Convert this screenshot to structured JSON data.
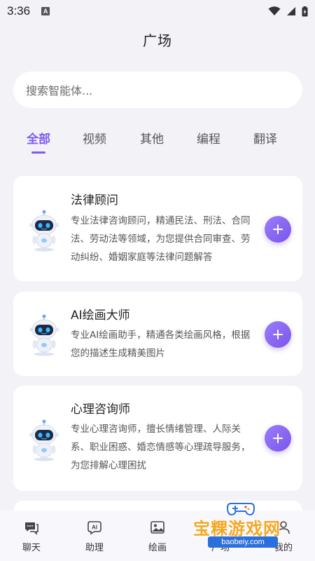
{
  "status_bar": {
    "time": "3:36",
    "notification_badge": "A"
  },
  "header": {
    "title": "广场"
  },
  "search": {
    "placeholder": "搜索智能体..."
  },
  "tabs": [
    {
      "label": "全部",
      "active": true
    },
    {
      "label": "视频",
      "active": false
    },
    {
      "label": "其他",
      "active": false
    },
    {
      "label": "编程",
      "active": false
    },
    {
      "label": "翻译",
      "active": false
    }
  ],
  "cards": [
    {
      "title": "法律顾问",
      "desc_lines": [
        "专业法律咨询顾问，精通民法、刑法、合同",
        "法、劳动法等领域，为您提供合同审查、劳",
        "动纠纷、婚姻家庭等法律问题解答"
      ],
      "avatar_icon": "robot-avatar-icon",
      "action_icon": "plus-icon"
    },
    {
      "title": "AI绘画大师",
      "desc_lines": [
        "专业AI绘画助手，精通各类绘画风格，根据",
        "您的描述生成精美图片"
      ],
      "avatar_icon": "robot-avatar-icon",
      "action_icon": "plus-icon"
    },
    {
      "title": "心理咨询师",
      "desc_lines": [
        "专业心理咨询师，擅长情绪管理、人际关",
        "系、职业困惑、婚恋情感等心理疏导服务，",
        "为您排解心理困扰"
      ],
      "avatar_icon": "robot-avatar-icon",
      "action_icon": "plus-icon"
    }
  ],
  "bottom_nav": [
    {
      "label": "聊天",
      "icon": "chat-icon"
    },
    {
      "label": "助理",
      "icon": "ai-assistant-icon"
    },
    {
      "label": "绘画",
      "icon": "image-icon"
    },
    {
      "label": "广场",
      "icon": "square-icon"
    },
    {
      "label": "我的",
      "icon": "user-icon"
    }
  ],
  "watermark": {
    "text": "宝粿游戏网",
    "url": "baobeiy.com"
  },
  "colors": {
    "accent": "#7c5cf0",
    "background": "#f3f2f7",
    "card": "#ffffff"
  }
}
